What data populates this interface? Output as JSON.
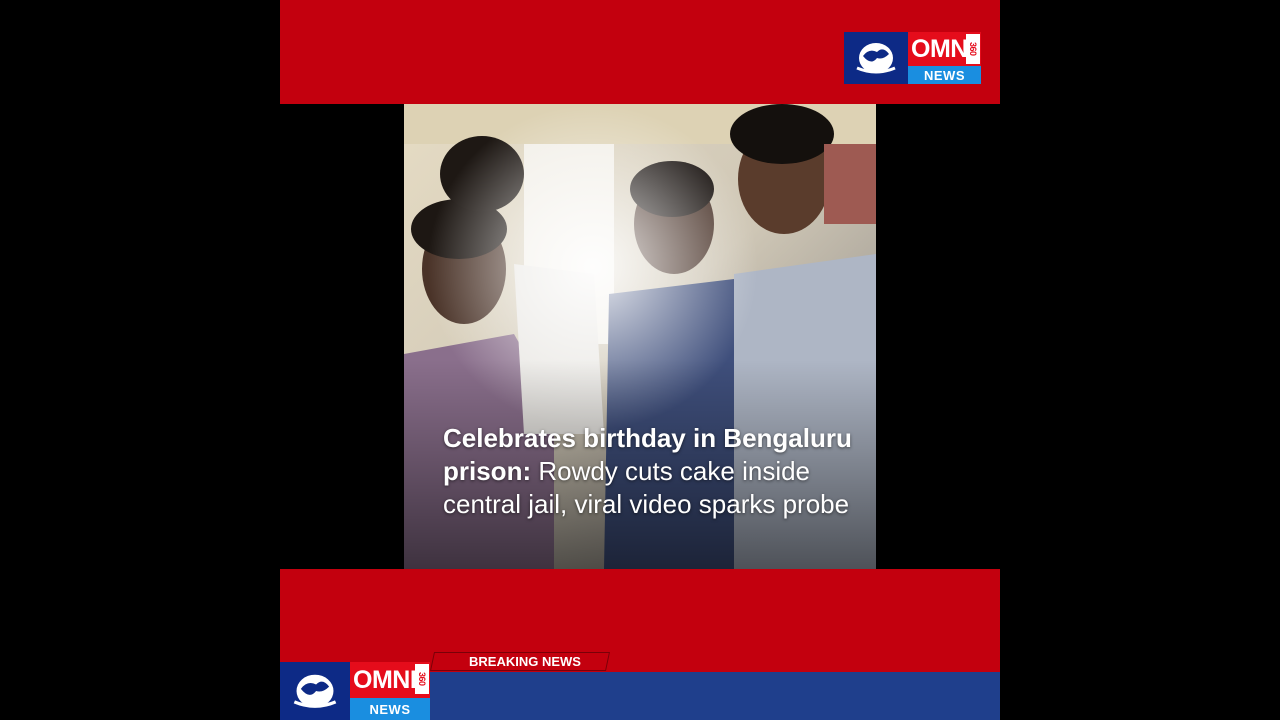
{
  "brand": {
    "name": "OMNI",
    "number": "360",
    "sub": "NEWS"
  },
  "caption": {
    "lead": "Celebrates birthday in Bengaluru prison:",
    "body": " Rowdy cuts cake inside central jail, viral video sparks probe"
  },
  "ticker": {
    "label": "BREAKING NEWS"
  },
  "colors": {
    "band_red": "#c3000e",
    "ticker_blue": "#1f3f8c",
    "logo_red": "#e50c1b",
    "logo_blue": "#1a8ee0"
  },
  "icons": [
    "globe-icon"
  ]
}
